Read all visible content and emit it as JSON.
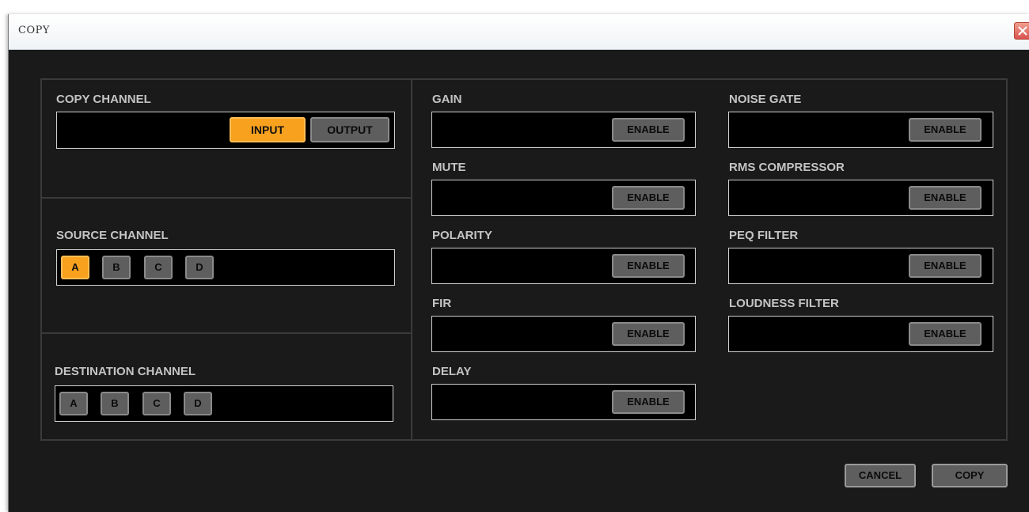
{
  "window": {
    "title": "COPY"
  },
  "copy_channel": {
    "label": "COPY CHANNEL",
    "options": [
      "INPUT",
      "OUTPUT"
    ],
    "selected": "INPUT"
  },
  "source_channel": {
    "label": "SOURCE CHANNEL",
    "options": [
      "A",
      "B",
      "C",
      "D"
    ],
    "selected": "A"
  },
  "destination_channel": {
    "label": "DESTINATION CHANNEL",
    "options": [
      "A",
      "B",
      "C",
      "D"
    ],
    "selected": null
  },
  "params": {
    "enable_label": "ENABLE",
    "gain": "GAIN",
    "mute": "MUTE",
    "polarity": "POLARITY",
    "fir": "FIR",
    "delay": "DELAY",
    "noise_gate": "NOISE GATE",
    "rms_compressor": "RMS COMPRESSOR",
    "peq_filter": "PEQ FILTER",
    "loudness_filter": "LOUDNESS FILTER"
  },
  "actions": {
    "cancel": "CANCEL",
    "copy": "COPY"
  },
  "colors": {
    "accent": "#f7a11e",
    "button": "#5e5e5e",
    "background": "#1a1a1a"
  }
}
